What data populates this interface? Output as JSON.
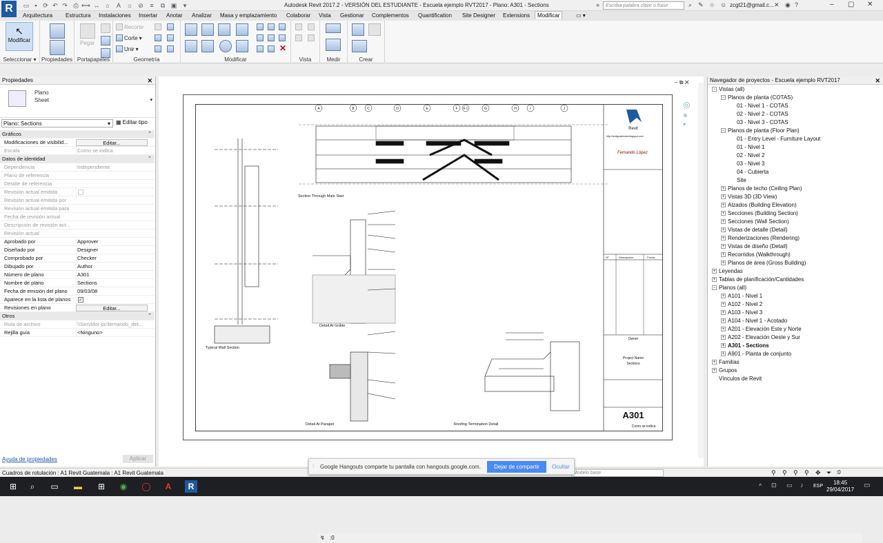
{
  "titlebar": {
    "app_letter": "R",
    "title": "Autodesk Revit 2017.2 - VERSIÓN DEL ESTUDIANTE -     Escuela ejemplo RVT2017 - Plano: A301 - Sections",
    "search_placeholder": "Escriba palabra clave o frase",
    "user": "zcgt21@gmail.c..."
  },
  "tabs": [
    "Arquitectura",
    "Estructura",
    "Instalaciones",
    "Insertar",
    "Anotar",
    "Analizar",
    "Masa y emplazamiento",
    "Colaborar",
    "Vista",
    "Gestionar",
    "Complementos",
    "Quantification",
    "Site Designer",
    "Extensions",
    "Modificar"
  ],
  "active_tab": "Modificar",
  "ribbon": {
    "modificar_label": "Modificar",
    "pegar_label": "Pegar",
    "recortar_label": "Recorte",
    "corte_label": "Corte",
    "unir_label": "Unir",
    "groups": [
      "Seleccionar",
      "Propiedades",
      "Portapapeles",
      "Geometría",
      "Modificar",
      "Vista",
      "Medir",
      "Crear"
    ]
  },
  "properties": {
    "title": "Propiedades",
    "type_name": "Plano",
    "type_sub": "Sheet",
    "filter": "Plano: Sections",
    "edit_type": "Editar tipo",
    "rows": [
      {
        "k": "Gráficos",
        "v": "",
        "kind": "cat"
      },
      {
        "k": "Modificaciones de visibilid...",
        "v": "Editar...",
        "kind": "btn"
      },
      {
        "k": "Escala",
        "v": "Como se indica",
        "kind": "grey"
      },
      {
        "k": "Datos de identidad",
        "v": "",
        "kind": "cat"
      },
      {
        "k": "Dependencia",
        "v": "Independiente",
        "kind": "grey"
      },
      {
        "k": "Plano de referencia",
        "v": "",
        "kind": "grey"
      },
      {
        "k": "Detalle de referencia",
        "v": "",
        "kind": "grey"
      },
      {
        "k": "Revisión actual emitida",
        "v": "",
        "kind": "greychk"
      },
      {
        "k": "Revisión actual emitida por",
        "v": "",
        "kind": "grey"
      },
      {
        "k": "Revisión actual emitida para",
        "v": "",
        "kind": "grey"
      },
      {
        "k": "Fecha de revisión actual",
        "v": "",
        "kind": "grey"
      },
      {
        "k": "Descripción de revisión act...",
        "v": "",
        "kind": "grey"
      },
      {
        "k": "Revisión actual",
        "v": "",
        "kind": "grey"
      },
      {
        "k": "Aprobado por",
        "v": "Approver",
        "kind": "n"
      },
      {
        "k": "Diseñado por",
        "v": "Designer",
        "kind": "n"
      },
      {
        "k": "Comprobado por",
        "v": "Checker",
        "kind": "n"
      },
      {
        "k": "Dibujado por",
        "v": "Author",
        "kind": "n"
      },
      {
        "k": "Número de plano",
        "v": "A301",
        "kind": "n"
      },
      {
        "k": "Nombre de plano",
        "v": "Sections",
        "kind": "n"
      },
      {
        "k": "Fecha de emisión del plano",
        "v": "09/03/08",
        "kind": "n"
      },
      {
        "k": "Aparece en la lista de planos",
        "v": "✓",
        "kind": "chk"
      },
      {
        "k": "Revisiones en plano",
        "v": "Editar...",
        "kind": "btn"
      },
      {
        "k": "Otros",
        "v": "",
        "kind": "cat"
      },
      {
        "k": "Ruta de archivo",
        "v": "\\\\Servidor-pc\\fernando_det...",
        "kind": "grey"
      },
      {
        "k": "Rejilla guía",
        "v": "<Ninguno>",
        "kind": "n"
      }
    ],
    "help": "Ayuda de propiedades",
    "apply": "Aplicar"
  },
  "drawing": {
    "titles": [
      "Section Through Main Stair",
      "Typical Wall Section",
      "Detail At Grade",
      "Detail At Parapet",
      "Roofing Termination Detail"
    ],
    "brand": "Revit",
    "brand_url": "http://revitguatemala.blogspot.com",
    "signature": "Fernando López",
    "rev_headers": [
      "Nº",
      "Descripción",
      "Fecha"
    ],
    "owner": "Owner",
    "project_name": "Project Name",
    "sheet_name": "Sections",
    "sheet_number": "A301",
    "scale": "Como se indica",
    "grid_bubbles": [
      "A",
      "B",
      "C",
      "D",
      "E",
      "F",
      "F.1",
      "G",
      "H",
      "I",
      "J"
    ]
  },
  "browser": {
    "title": "Navegador de proyectos - Escuela ejemplo RVT2017",
    "nodes": [
      {
        "t": "Vistas (all)",
        "lvl": 0,
        "exp": "-"
      },
      {
        "t": "Planos de planta (COTAS)",
        "lvl": 1,
        "exp": "-"
      },
      {
        "t": "01 - Nivel 1 - COTAS",
        "lvl": 2,
        "exp": ""
      },
      {
        "t": "02 - Nivel 2 - COTAS",
        "lvl": 2,
        "exp": ""
      },
      {
        "t": "03 - Nivel 3 - COTAS",
        "lvl": 2,
        "exp": ""
      },
      {
        "t": "Planos de planta (Floor Plan)",
        "lvl": 1,
        "exp": "-"
      },
      {
        "t": "01 - Entry Level - Furniture Layout",
        "lvl": 2,
        "exp": ""
      },
      {
        "t": "01 - Nivel 1",
        "lvl": 2,
        "exp": ""
      },
      {
        "t": "02 - Nivel 2",
        "lvl": 2,
        "exp": ""
      },
      {
        "t": "03 - Nivel 3",
        "lvl": 2,
        "exp": ""
      },
      {
        "t": "04 - Cubierta",
        "lvl": 2,
        "exp": ""
      },
      {
        "t": "Site",
        "lvl": 2,
        "exp": ""
      },
      {
        "t": "Planos de techo (Ceiling Plan)",
        "lvl": 1,
        "exp": "+"
      },
      {
        "t": "Vistas 3D (3D View)",
        "lvl": 1,
        "exp": "+"
      },
      {
        "t": "Alzados (Building Elevation)",
        "lvl": 1,
        "exp": "+"
      },
      {
        "t": "Secciones (Building Section)",
        "lvl": 1,
        "exp": "+"
      },
      {
        "t": "Secciones (Wall Section)",
        "lvl": 1,
        "exp": "+"
      },
      {
        "t": "Vistas de detalle (Detail)",
        "lvl": 1,
        "exp": "+"
      },
      {
        "t": "Renderizaciones (Rendering)",
        "lvl": 1,
        "exp": "+"
      },
      {
        "t": "Vistas de diseño (Detail)",
        "lvl": 1,
        "exp": "+"
      },
      {
        "t": "Recorridos (Walkthrough)",
        "lvl": 1,
        "exp": "+"
      },
      {
        "t": "Planos de área (Gross Building)",
        "lvl": 1,
        "exp": "+"
      },
      {
        "t": "Leyendas",
        "lvl": 0,
        "exp": "+"
      },
      {
        "t": "Tablas de planificación/Cantidades",
        "lvl": 0,
        "exp": "+"
      },
      {
        "t": "Planos (all)",
        "lvl": 0,
        "exp": "-"
      },
      {
        "t": "A101 - Nivel 1",
        "lvl": 1,
        "exp": "+"
      },
      {
        "t": "A102 - Nivel 2",
        "lvl": 1,
        "exp": "+"
      },
      {
        "t": "A103 - Nivel 3",
        "lvl": 1,
        "exp": "+"
      },
      {
        "t": "A104 - Nivel 1 - Acotado",
        "lvl": 1,
        "exp": "+"
      },
      {
        "t": "A201 - Elevación Este y Norte",
        "lvl": 1,
        "exp": "+"
      },
      {
        "t": "A202 - Elevación Oeste y Sur",
        "lvl": 1,
        "exp": "+"
      },
      {
        "t": "A301 - Sections",
        "lvl": 1,
        "exp": "+",
        "bold": true
      },
      {
        "t": "A901 - Planta de conjunto",
        "lvl": 1,
        "exp": "+"
      },
      {
        "t": "Familias",
        "lvl": 0,
        "exp": "+"
      },
      {
        "t": "Grupos",
        "lvl": 0,
        "exp": "+"
      },
      {
        "t": "Vínculos de Revit",
        "lvl": 0,
        "exp": ""
      }
    ]
  },
  "hangouts": {
    "text": "Google Hangouts comparte tu pantalla con hangouts.google.com.",
    "stop": "Dejar de compartir",
    "hide": "Ocultar"
  },
  "statusbar": {
    "text": "Cuadros de rotulación : A1 Revit Guatemala : A1 Revit Guatemala",
    "model": "Modelo base",
    "scale_counter": ":0",
    "view_zoom": "1 : 1"
  },
  "taskbar": {
    "lang": "ESP",
    "time": "18:45",
    "date": "29/04/2017"
  }
}
